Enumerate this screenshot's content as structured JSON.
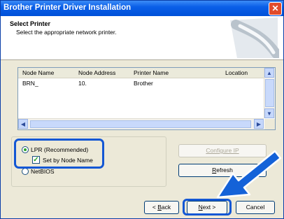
{
  "window": {
    "title": "Brother Printer Driver Installation",
    "close_glyph": "✕"
  },
  "header": {
    "title": "Select Printer",
    "subtitle": "Select the appropriate network printer."
  },
  "printer_list": {
    "columns": [
      "Node Name",
      "Node Address",
      "Printer Name",
      "Location"
    ],
    "rows": [
      {
        "node_name": "BRN_",
        "node_address": "10.",
        "printer_name": "Brother",
        "location": ""
      }
    ]
  },
  "options": {
    "lpr_label": "LPR (Recommended)",
    "set_by_node_label": "Set by Node Name",
    "netbios_label": "NetBIOS",
    "lpr_selected": true,
    "set_by_node_checked": true
  },
  "buttons": {
    "configure_ip": "Configure IP",
    "refresh_prefix": "R",
    "refresh_rest": "efresh",
    "back_prefix": "< ",
    "back_key": "B",
    "back_rest": "ack",
    "next_key": "N",
    "next_rest": "ext >",
    "cancel": "Cancel"
  },
  "colors": {
    "highlight": "#1357d4",
    "arrow": "#1462d8",
    "title_bar": "#0050d8"
  },
  "icons": {
    "close": "close-icon",
    "wizard": "wizard-graphic",
    "arrow": "pointer-arrow-annotation"
  }
}
